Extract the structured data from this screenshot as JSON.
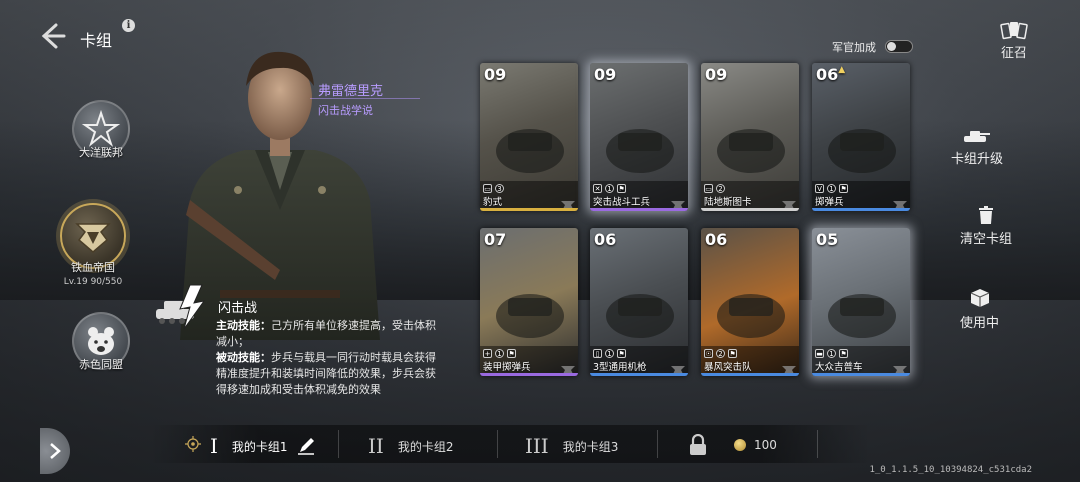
{
  "header": {
    "title": "卡组",
    "info_label": "i"
  },
  "factions": [
    {
      "name": "大洋联邦",
      "icon": "star-eagle-icon",
      "active": false
    },
    {
      "name": "铁血帝国",
      "icon": "iron-eagle-icon",
      "active": true,
      "level": "Lv.19  90/550"
    },
    {
      "name": "赤色同盟",
      "icon": "bear-icon",
      "active": false
    }
  ],
  "commander": {
    "name": "弗雷德里克",
    "doctrine": "闪击战学说",
    "tactic_name": "闪击战",
    "active_skill_label": "主动技能：",
    "active_skill_text": "己方所有单位移速提高，受击体积减小；",
    "passive_skill_label": "被动技能：",
    "passive_skill_text": "步兵与载具一同行动时载具会获得精准度提升和装填时间降低的效果，步兵会获得移速加成和受击体积减免的效果"
  },
  "officer_bonus": {
    "label": "军官加成",
    "enabled": false
  },
  "cards": [
    {
      "cost": "09",
      "name": "豹式",
      "meta": [
        "tank",
        "3"
      ],
      "rarity": "#d8b040",
      "glow": false
    },
    {
      "cost": "09",
      "name": "突击战斗工兵",
      "meta": [
        "rifle",
        "1",
        "flag"
      ],
      "rarity": "#9a6ae0",
      "glow": true
    },
    {
      "cost": "09",
      "name": "陆地斯图卡",
      "meta": [
        "tank",
        "2"
      ],
      "rarity": "#cfcfcf",
      "glow": false
    },
    {
      "cost": "06",
      "name": "掷弹兵",
      "meta": [
        "V",
        "1",
        "flag"
      ],
      "rarity": "#4a8ae0",
      "glow": false,
      "upgrade": true
    },
    {
      "cost": "07",
      "name": "装甲掷弹兵",
      "meta": [
        "+",
        "1",
        "flag"
      ],
      "rarity": "#9a6ae0",
      "glow": false
    },
    {
      "cost": "06",
      "name": "3型通用机枪",
      "meta": [
        "mg",
        "1",
        "flag"
      ],
      "rarity": "#4a8ae0",
      "glow": false
    },
    {
      "cost": "06",
      "name": "暴风突击队",
      "meta": [
        "skull",
        "2",
        "flag"
      ],
      "rarity": "#4a8ae0",
      "glow": false
    },
    {
      "cost": "05",
      "name": "大众吉普车",
      "meta": [
        "car",
        "1",
        "flag"
      ],
      "rarity": "#4a8ae0",
      "glow": true
    }
  ],
  "side_menu": {
    "recruit": "征召",
    "upgrade": "卡组升级",
    "clear": "清空卡组",
    "in_use": "使用中"
  },
  "decks": [
    {
      "numeral": "I",
      "name": "我的卡组1",
      "active": true
    },
    {
      "numeral": "II",
      "name": "我的卡组2",
      "active": false
    },
    {
      "numeral": "III",
      "name": "我的卡组3",
      "active": false
    }
  ],
  "locked_slot": {
    "cost": "100"
  },
  "version": "1_0_1.1.5_10_10394824_c531cda2"
}
